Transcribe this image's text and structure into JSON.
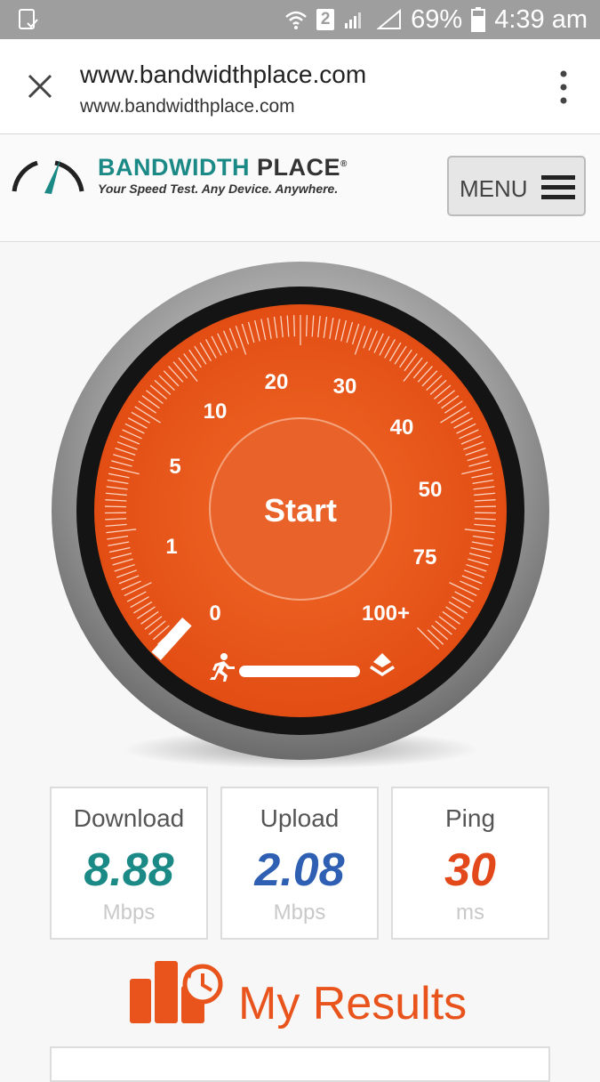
{
  "statusbar": {
    "network_badge": "2",
    "battery": "69%",
    "time": "4:39 am"
  },
  "urlbar": {
    "title": "www.bandwidthplace.com",
    "url": "www.bandwidthplace.com"
  },
  "header": {
    "brand_part1": "BANDWIDTH",
    "brand_part2": "PLACE",
    "trademark": "®",
    "tagline": "Your Speed Test.  Any Device.  Anywhere.",
    "menu_label": "MENU"
  },
  "gauge": {
    "start_label": "Start",
    "scale_labels": [
      "0",
      "1",
      "5",
      "10",
      "20",
      "30",
      "40",
      "50",
      "75",
      "100+"
    ],
    "progress": 0
  },
  "results": [
    {
      "label": "Download",
      "value": "8.88",
      "unit": "Mbps",
      "color": "#1b8a87"
    },
    {
      "label": "Upload",
      "value": "2.08",
      "unit": "Mbps",
      "color": "#2e5fb3"
    },
    {
      "label": "Ping",
      "value": "30",
      "unit": "ms",
      "color": "#e2481a"
    }
  ],
  "my_results": {
    "label": "My Results"
  },
  "colors": {
    "accent_orange": "#e8541c",
    "teal": "#1b8a87",
    "blue": "#2e5fb3"
  },
  "icons": {
    "close": "close-icon",
    "kebab": "more-vert-icon",
    "menu": "hamburger-icon",
    "runner": "runner-icon",
    "layers": "layers-icon",
    "results": "bar-chart-history-icon"
  }
}
